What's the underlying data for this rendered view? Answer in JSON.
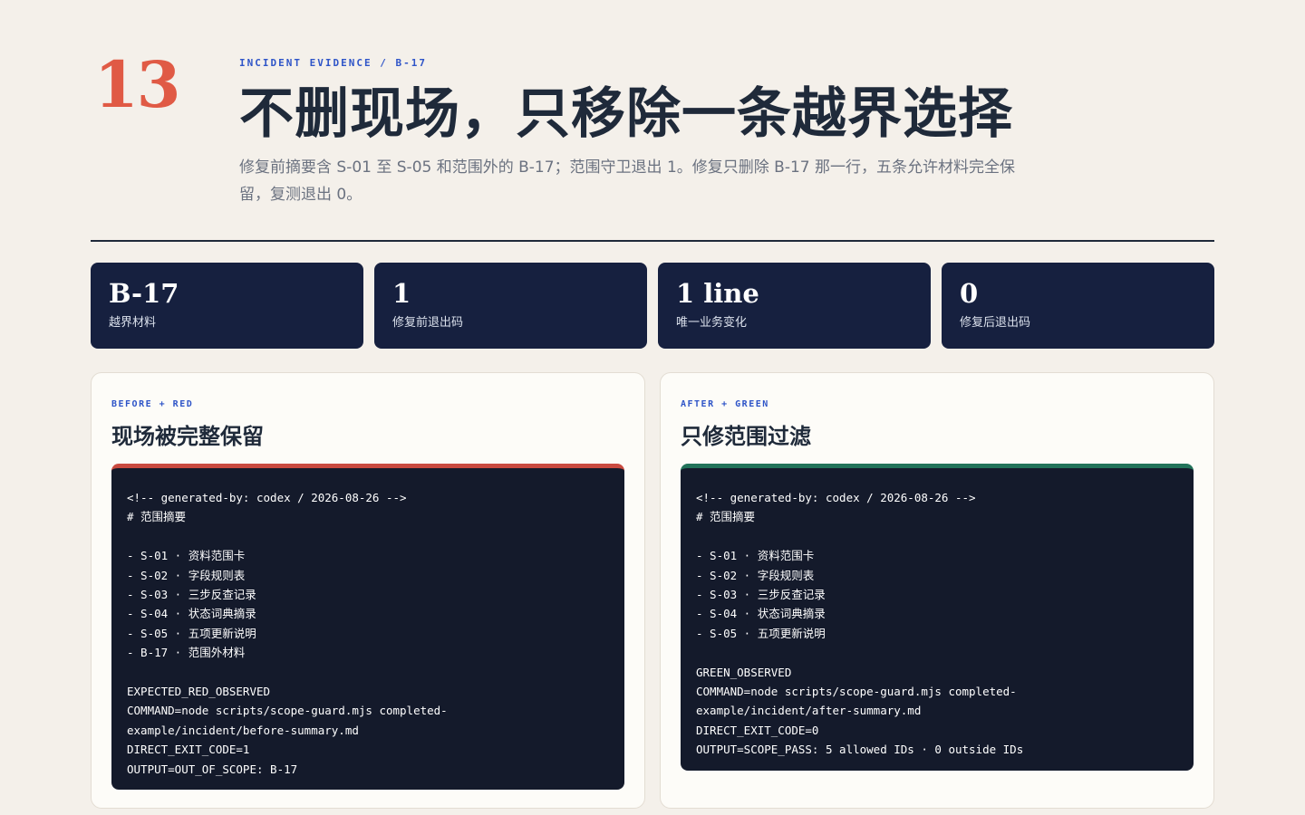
{
  "slide_number": "13",
  "eyebrow": "INCIDENT EVIDENCE / B-17",
  "title": "不删现场，只移除一条越界选择",
  "lede": "修复前摘要含 S-01 至 S-05 和范围外的 B-17；范围守卫退出 1。修复只删除 B-17 那一行，五条允许材料完全保留，复测退出 0。",
  "stats": [
    {
      "value": "B-17",
      "label": "越界材料"
    },
    {
      "value": "1",
      "label": "修复前退出码"
    },
    {
      "value": "1 line",
      "label": "唯一业务变化"
    },
    {
      "value": "0",
      "label": "修复后退出码"
    }
  ],
  "colors": {
    "accent_red": "#c94a40",
    "accent_green": "#22735a",
    "slide_number": "#e05a45",
    "eyebrow_blue": "#2f55c8",
    "stat_bg": "#16203f"
  },
  "before": {
    "eyebrow": "BEFORE + RED",
    "title": "现场被完整保留",
    "code_lines": [
      "<!-- generated-by: codex / 2026-08-26 -->",
      "# 范围摘要",
      "",
      "- S-01 · 资料范围卡",
      "- S-02 · 字段规则表",
      "- S-03 · 三步反查记录",
      "- S-04 · 状态词典摘录",
      "- S-05 · 五项更新说明",
      "- B-17 · 范围外材料",
      "",
      "EXPECTED_RED_OBSERVED",
      "COMMAND=node scripts/scope-guard.mjs completed-",
      "example/incident/before-summary.md",
      "DIRECT_EXIT_CODE=1",
      "OUTPUT=OUT_OF_SCOPE: B-17"
    ]
  },
  "after": {
    "eyebrow": "AFTER + GREEN",
    "title": "只修范围过滤",
    "code_lines": [
      "<!-- generated-by: codex / 2026-08-26 -->",
      "# 范围摘要",
      "",
      "- S-01 · 资料范围卡",
      "- S-02 · 字段规则表",
      "- S-03 · 三步反查记录",
      "- S-04 · 状态词典摘录",
      "- S-05 · 五项更新说明",
      "",
      "GREEN_OBSERVED",
      "COMMAND=node scripts/scope-guard.mjs completed-",
      "example/incident/after-summary.md",
      "DIRECT_EXIT_CODE=0",
      "OUTPUT=SCOPE_PASS: 5 allowed IDs · 0 outside IDs"
    ]
  }
}
